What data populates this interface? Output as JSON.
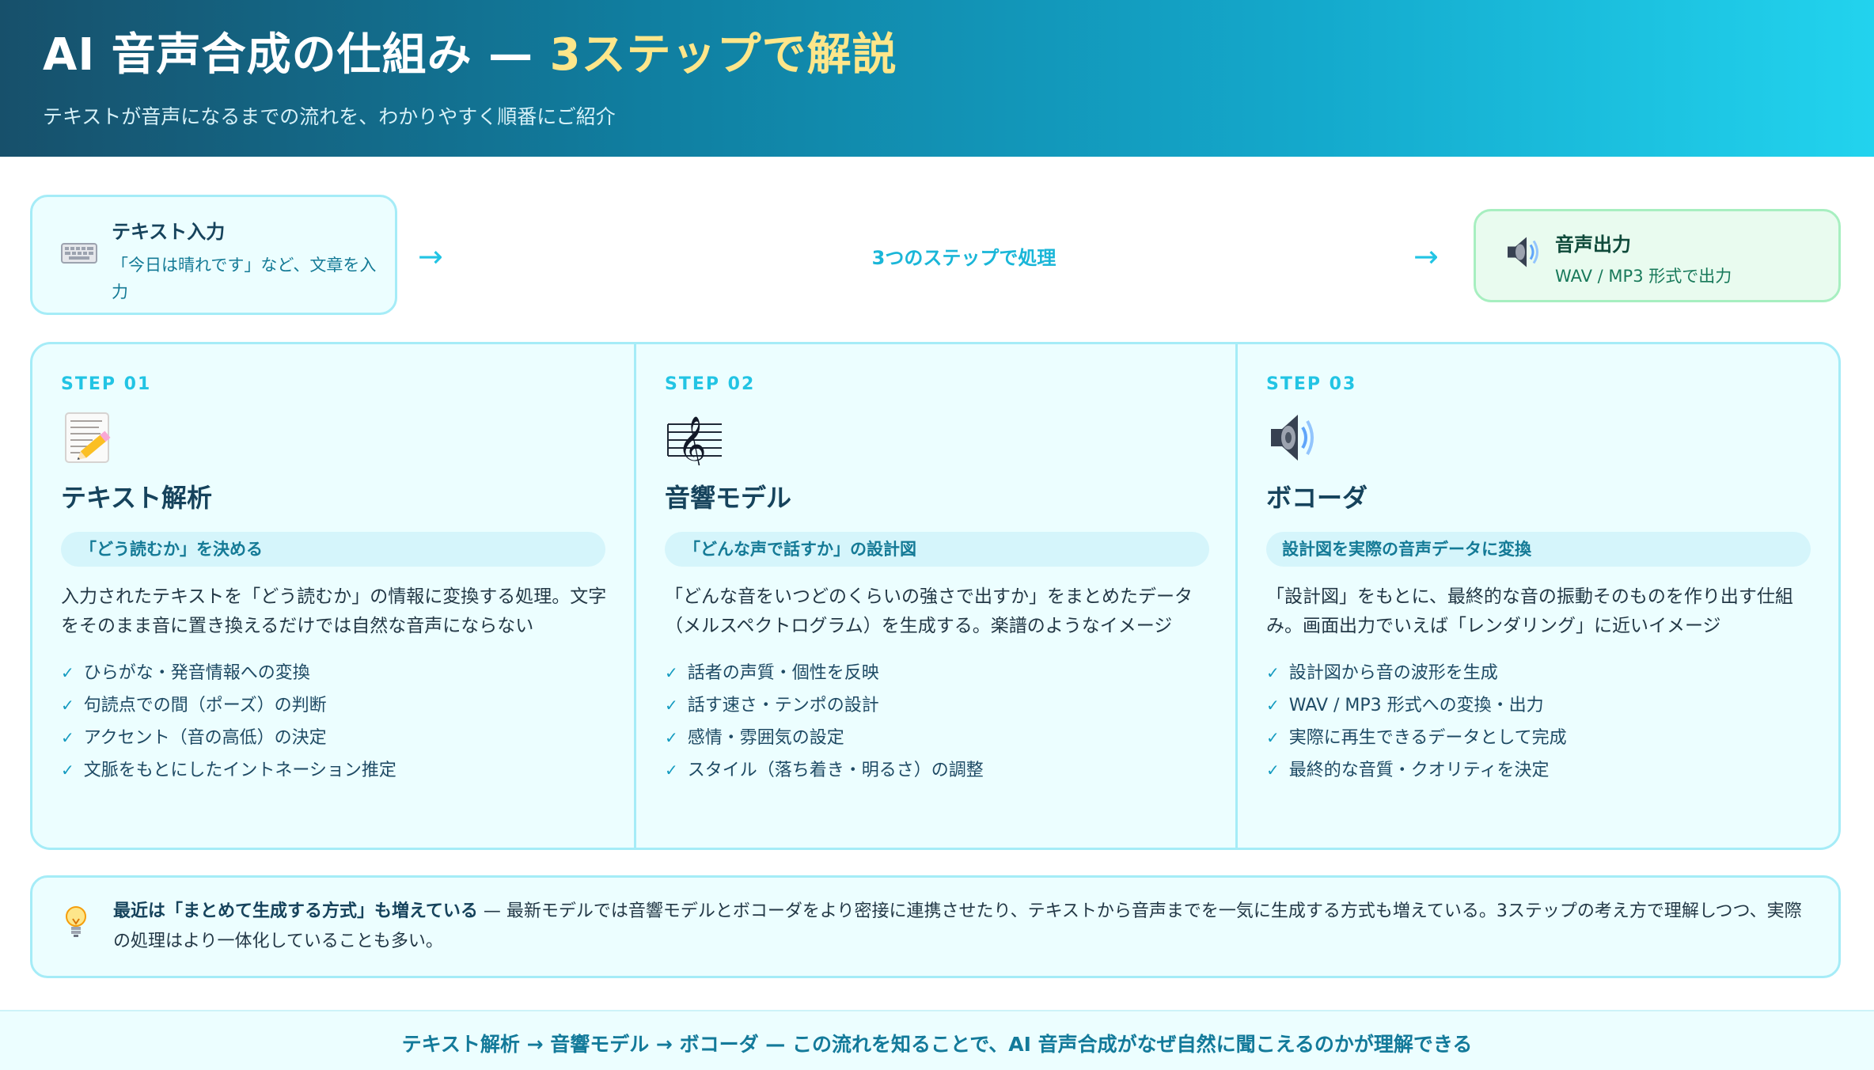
{
  "header": {
    "title_main": "AI 音声合成の仕組み — ",
    "title_accent": "3ステップで解説",
    "subtitle": "テキストが音声になるまでの流れを、わかりやすく順番にご紹介"
  },
  "flow": {
    "input": {
      "icon": "keyboard-icon",
      "title": "テキスト入力",
      "desc": "「今日は晴れです」など、文章を入力"
    },
    "arrow": "→",
    "center_label": "3つのステップで処理",
    "output": {
      "icon": "speaker-icon",
      "title": "音声出力",
      "desc": "WAV / MP3 形式で出力"
    }
  },
  "steps": [
    {
      "label": "STEP 01",
      "icon": "memo-pencil-icon",
      "title": "テキスト解析",
      "pill": "「どう読むか」を決める",
      "desc": "入力されたテキストを「どう読むか」の情報に変換する処理。文字をそのまま音に置き換えるだけでは自然な音声にならない",
      "items": [
        "ひらがな・発音情報への変換",
        "句読点での間（ポーズ）の判断",
        "アクセント（音の高低）の決定",
        "文脈をもとにしたイントネーション推定"
      ]
    },
    {
      "label": "STEP 02",
      "icon": "treble-clef-icon",
      "title": "音響モデル",
      "pill": "「どんな声で話すか」の設計図",
      "desc": "「どんな音をいつどのくらいの強さで出すか」をまとめたデータ（メルスペクトログラム）を生成する。楽譜のようなイメージ",
      "items": [
        "話者の声質・個性を反映",
        "話す速さ・テンポの設計",
        "感情・雰囲気の設定",
        "スタイル（落ち着き・明るさ）の調整"
      ]
    },
    {
      "label": "STEP 03",
      "icon": "speaker-icon",
      "title": "ボコーダ",
      "pill": "設計図を実際の音声データに変換",
      "desc": "「設計図」をもとに、最終的な音の振動そのものを作り出す仕組み。画面出力でいえば「レンダリング」に近いイメージ",
      "items": [
        "設計図から音の波形を生成",
        "WAV / MP3 形式への変換・出力",
        "実際に再生できるデータとして完成",
        "最終的な音質・クオリティを決定"
      ]
    }
  ],
  "check_mark": "✓",
  "note": {
    "icon": "lightbulb-icon",
    "bold": "最近は「まとめて生成する方式」も増えている",
    "text": " — 最新モデルでは音響モデルとボコーダをより密接に連携させたり、テキストから音声までを一気に生成する方式も増えている。3ステップの考え方で理解しつつ、実際の処理はより一体化していることも多い。"
  },
  "footer": "テキスト解析 → 音響モデル → ボコーダ — この流れを知ることで、AI 音声合成がなぜ自然に聞こえるのかが理解できる"
}
